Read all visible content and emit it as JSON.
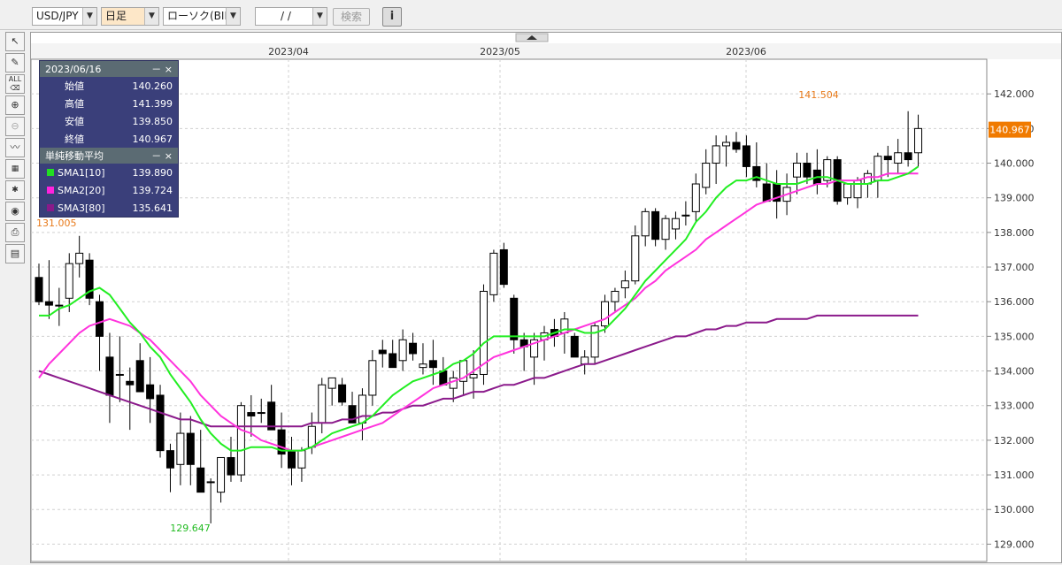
{
  "toolbar": {
    "symbol": "USD/JPY",
    "period": "日足",
    "price_type": "ローソク(BID)",
    "date_input": "/ /",
    "search_label": "検索",
    "info_label": "i"
  },
  "side_tools": [
    "cursor",
    "pencil",
    "all-eraser",
    "zoom-in",
    "zoom-out",
    "indicator",
    "chart-type",
    "favorites",
    "view",
    "print",
    "table"
  ],
  "ohlc_panel": {
    "date": "2023/06/16",
    "controls": "－ ×",
    "rows": [
      {
        "label": "始値",
        "value": "140.260"
      },
      {
        "label": "高値",
        "value": "141.399"
      },
      {
        "label": "安値",
        "value": "139.850"
      },
      {
        "label": "終値",
        "value": "140.967"
      }
    ],
    "sma_title": "単純移動平均",
    "sma_rows": [
      {
        "label": "SMA1[10]",
        "value": "139.890",
        "color": "#22dd22"
      },
      {
        "label": "SMA2[20]",
        "value": "139.724",
        "color": "#ff22dd"
      },
      {
        "label": "SMA3[80]",
        "value": "135.641",
        "color": "#8a1a8a"
      }
    ]
  },
  "colors": {
    "sma1": "#22ee22",
    "sma2": "#ff33dd",
    "sma3": "#8b1a8b",
    "current_price_bg": "#f07a00",
    "high_label": "#e87a1a",
    "low_label": "#22bb22"
  },
  "chart_data": {
    "type": "candlestick",
    "x_labels": [
      "2023/04",
      "2023/05",
      "2023/06"
    ],
    "y_ticks": [
      "142.000",
      "141.000",
      "140.000",
      "139.000",
      "138.000",
      "137.000",
      "136.000",
      "135.000",
      "134.000",
      "133.000",
      "132.000",
      "131.000",
      "130.000",
      "129.000"
    ],
    "ylim": [
      128.5,
      143.0
    ],
    "current_price": "140.967",
    "high_label": "141.504",
    "low_label": "129.647",
    "cut_label": "131.005",
    "candles": [
      [
        136.7,
        137.1,
        135.9,
        136.0
      ],
      [
        136.0,
        137.2,
        135.5,
        135.9
      ],
      [
        135.9,
        136.4,
        135.3,
        135.9
      ],
      [
        136.1,
        137.4,
        135.7,
        137.1
      ],
      [
        137.1,
        137.9,
        136.7,
        137.4
      ],
      [
        137.2,
        137.4,
        135.9,
        136.1
      ],
      [
        136.0,
        136.2,
        134.0,
        135.0
      ],
      [
        134.4,
        135.1,
        132.5,
        133.3
      ],
      [
        133.9,
        135.0,
        133.1,
        133.9
      ],
      [
        133.7,
        134.1,
        132.3,
        133.6
      ],
      [
        134.3,
        134.8,
        133.5,
        133.4
      ],
      [
        133.6,
        134.4,
        132.5,
        133.2
      ],
      [
        133.3,
        133.6,
        131.5,
        131.7
      ],
      [
        131.7,
        131.9,
        130.5,
        131.2
      ],
      [
        131.3,
        132.8,
        130.7,
        132.2
      ],
      [
        132.2,
        132.7,
        130.7,
        131.3
      ],
      [
        131.2,
        132.3,
        130.8,
        130.5
      ],
      [
        130.8,
        130.9,
        129.6,
        130.8
      ],
      [
        130.5,
        131.5,
        130.2,
        131.5
      ],
      [
        131.5,
        132.1,
        130.8,
        131.0
      ],
      [
        131.0,
        133.1,
        130.8,
        133.0
      ],
      [
        132.8,
        133.3,
        132.1,
        132.7
      ],
      [
        132.8,
        133.2,
        132.5,
        132.8
      ],
      [
        133.1,
        133.6,
        132.4,
        132.3
      ],
      [
        132.3,
        132.8,
        131.2,
        131.6
      ],
      [
        131.7,
        132.1,
        130.7,
        131.2
      ],
      [
        131.2,
        131.8,
        130.8,
        131.7
      ],
      [
        131.8,
        132.8,
        131.6,
        132.4
      ],
      [
        132.5,
        133.8,
        132.2,
        133.6
      ],
      [
        133.5,
        133.8,
        133.0,
        133.8
      ],
      [
        133.6,
        133.8,
        133.0,
        133.1
      ],
      [
        133.0,
        133.4,
        132.5,
        132.5
      ],
      [
        132.5,
        133.5,
        132.0,
        133.3
      ],
      [
        133.3,
        134.6,
        133.0,
        134.3
      ],
      [
        134.6,
        134.9,
        134.1,
        134.5
      ],
      [
        134.5,
        134.9,
        134.2,
        134.1
      ],
      [
        134.3,
        135.2,
        134.0,
        134.9
      ],
      [
        134.8,
        135.1,
        134.3,
        134.5
      ],
      [
        134.1,
        134.8,
        133.9,
        134.2
      ],
      [
        134.3,
        134.9,
        133.6,
        134.1
      ],
      [
        134.0,
        134.4,
        133.6,
        133.6
      ],
      [
        133.5,
        134.0,
        133.1,
        133.8
      ],
      [
        133.7,
        134.3,
        133.3,
        134.3
      ],
      [
        133.8,
        134.6,
        133.2,
        133.9
      ],
      [
        133.9,
        136.5,
        133.6,
        136.3
      ],
      [
        136.2,
        137.5,
        136.0,
        137.4
      ],
      [
        137.5,
        137.7,
        136.4,
        136.5
      ],
      [
        136.1,
        136.2,
        134.5,
        134.9
      ],
      [
        134.9,
        135.1,
        134.0,
        134.7
      ],
      [
        134.4,
        135.1,
        133.6,
        134.9
      ],
      [
        134.9,
        135.3,
        134.3,
        135.1
      ],
      [
        135.2,
        135.5,
        134.7,
        135.0
      ],
      [
        135.1,
        135.7,
        134.5,
        135.5
      ],
      [
        135.0,
        135.1,
        134.4,
        134.4
      ],
      [
        134.2,
        134.6,
        133.9,
        134.4
      ],
      [
        134.4,
        135.4,
        134.2,
        135.3
      ],
      [
        135.3,
        136.2,
        135.1,
        136.0
      ],
      [
        136.0,
        136.4,
        135.7,
        136.3
      ],
      [
        136.4,
        136.9,
        136.1,
        136.6
      ],
      [
        136.6,
        138.2,
        136.5,
        137.9
      ],
      [
        137.9,
        138.7,
        137.6,
        138.6
      ],
      [
        138.6,
        138.7,
        137.6,
        137.8
      ],
      [
        137.8,
        138.5,
        137.5,
        138.4
      ],
      [
        138.1,
        138.6,
        137.8,
        138.4
      ],
      [
        138.5,
        138.9,
        138.2,
        138.5
      ],
      [
        138.6,
        139.7,
        138.3,
        139.4
      ],
      [
        139.3,
        140.4,
        139.1,
        140.0
      ],
      [
        140.0,
        140.8,
        139.4,
        140.5
      ],
      [
        140.5,
        140.8,
        139.9,
        140.6
      ],
      [
        140.6,
        140.9,
        140.3,
        140.4
      ],
      [
        140.5,
        140.8,
        139.6,
        139.9
      ],
      [
        139.9,
        140.6,
        139.3,
        139.5
      ],
      [
        139.4,
        140.0,
        138.9,
        138.9
      ],
      [
        139.4,
        139.8,
        138.4,
        138.9
      ],
      [
        138.9,
        139.7,
        138.5,
        139.3
      ],
      [
        139.6,
        140.3,
        139.1,
        140.0
      ],
      [
        140.0,
        140.3,
        139.4,
        139.6
      ],
      [
        139.8,
        140.4,
        139.1,
        139.4
      ],
      [
        139.5,
        140.2,
        139.3,
        140.1
      ],
      [
        140.1,
        140.2,
        138.8,
        138.9
      ],
      [
        139.0,
        139.4,
        138.8,
        139.4
      ],
      [
        139.0,
        139.6,
        138.7,
        139.5
      ],
      [
        139.4,
        139.8,
        139.0,
        139.7
      ],
      [
        139.5,
        140.3,
        139.0,
        140.2
      ],
      [
        140.2,
        140.5,
        139.6,
        140.1
      ],
      [
        140.0,
        140.7,
        139.7,
        140.3
      ],
      [
        140.3,
        141.5,
        139.9,
        140.1
      ],
      [
        140.3,
        141.4,
        139.9,
        141.0
      ]
    ],
    "sma1": [
      135.6,
      135.6,
      135.8,
      135.9,
      136.1,
      136.3,
      136.4,
      136.2,
      135.8,
      135.4,
      135.1,
      134.7,
      134.4,
      133.9,
      133.5,
      133.1,
      132.6,
      132.2,
      131.9,
      131.7,
      131.7,
      131.8,
      131.8,
      131.8,
      131.7,
      131.7,
      131.7,
      131.8,
      132.0,
      132.2,
      132.3,
      132.4,
      132.5,
      132.7,
      133.0,
      133.3,
      133.5,
      133.7,
      133.8,
      133.9,
      134.0,
      134.2,
      134.3,
      134.5,
      134.8,
      135.0,
      135.0,
      135.0,
      135.0,
      135.0,
      135.0,
      135.1,
      135.2,
      135.2,
      135.1,
      135.1,
      135.2,
      135.5,
      135.8,
      136.2,
      136.6,
      136.9,
      137.2,
      137.5,
      137.8,
      138.3,
      138.6,
      139.0,
      139.3,
      139.5,
      139.5,
      139.6,
      139.5,
      139.4,
      139.4,
      139.4,
      139.5,
      139.6,
      139.6,
      139.5,
      139.4,
      139.4,
      139.4,
      139.5,
      139.5,
      139.6,
      139.7,
      139.9
    ],
    "sma2": [
      133.8,
      134.2,
      134.5,
      134.8,
      135.1,
      135.3,
      135.4,
      135.5,
      135.4,
      135.3,
      135.1,
      134.9,
      134.6,
      134.3,
      134.0,
      133.7,
      133.3,
      133.0,
      132.7,
      132.5,
      132.3,
      132.2,
      132.0,
      131.9,
      131.8,
      131.7,
      131.7,
      131.8,
      131.9,
      132.0,
      132.1,
      132.2,
      132.3,
      132.4,
      132.5,
      132.7,
      132.9,
      133.1,
      133.3,
      133.5,
      133.6,
      133.7,
      133.8,
      134.0,
      134.2,
      134.4,
      134.5,
      134.6,
      134.7,
      134.8,
      134.9,
      135.0,
      135.1,
      135.2,
      135.3,
      135.4,
      135.5,
      135.7,
      135.9,
      136.1,
      136.4,
      136.6,
      136.9,
      137.1,
      137.3,
      137.5,
      137.8,
      138.0,
      138.2,
      138.4,
      138.6,
      138.8,
      138.9,
      139.0,
      139.1,
      139.2,
      139.3,
      139.4,
      139.4,
      139.5,
      139.5,
      139.5,
      139.6,
      139.6,
      139.7,
      139.7,
      139.7,
      139.7
    ],
    "sma3": [
      134.0,
      133.9,
      133.8,
      133.7,
      133.6,
      133.5,
      133.4,
      133.3,
      133.2,
      133.1,
      133.0,
      132.9,
      132.8,
      132.7,
      132.6,
      132.6,
      132.5,
      132.4,
      132.4,
      132.4,
      132.4,
      132.4,
      132.4,
      132.4,
      132.4,
      132.4,
      132.4,
      132.5,
      132.5,
      132.5,
      132.6,
      132.6,
      132.7,
      132.7,
      132.8,
      132.8,
      132.9,
      133.0,
      133.0,
      133.1,
      133.2,
      133.2,
      133.3,
      133.4,
      133.4,
      133.5,
      133.6,
      133.6,
      133.7,
      133.8,
      133.8,
      133.9,
      134.0,
      134.1,
      134.2,
      134.2,
      134.3,
      134.4,
      134.5,
      134.6,
      134.7,
      134.8,
      134.9,
      135.0,
      135.0,
      135.1,
      135.2,
      135.2,
      135.3,
      135.3,
      135.4,
      135.4,
      135.4,
      135.5,
      135.5,
      135.5,
      135.5,
      135.6,
      135.6,
      135.6,
      135.6,
      135.6,
      135.6,
      135.6,
      135.6,
      135.6,
      135.6,
      135.6
    ]
  }
}
